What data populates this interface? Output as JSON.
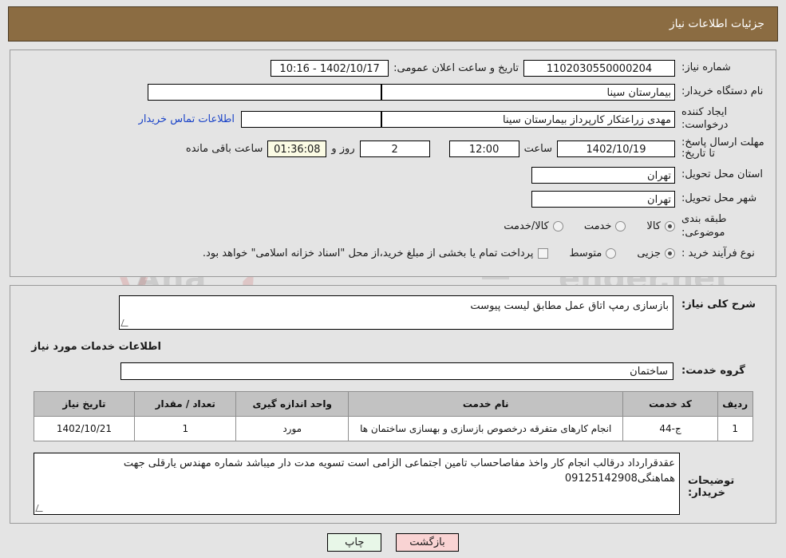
{
  "header": {
    "title": "جزئیات اطلاعات نیاز"
  },
  "form": {
    "need_number_label": "شماره نیاز:",
    "need_number_value": "1102030550000204",
    "announce_datetime_label": "تاریخ و ساعت اعلان عمومی:",
    "announce_datetime_value": "1402/10/17 - 10:16",
    "buyer_org_label": "نام دستگاه خریدار:",
    "buyer_org_value": "بیمارستان سینا",
    "blank_field_value": "",
    "creator_label": "ایجاد کننده درخواست:",
    "creator_value": "مهدی  زراعتکار  کارپرداز بیمارستان سینا",
    "contact_link": "اطلاعات تماس خریدار",
    "deadline_label": "مهلت ارسال پاسخ: تا تاریخ:",
    "deadline_date": "1402/10/19",
    "hour_label": "ساعت",
    "deadline_time": "12:00",
    "days_value": "2",
    "days_text": "روز و",
    "timer_value": "01:36:08",
    "remaining_text": "ساعت باقی مانده",
    "province_label": "استان محل تحویل:",
    "province_value": "تهران",
    "city_label": "شهر محل تحویل:",
    "city_value": "تهران",
    "category_label": "طبقه بندی موضوعی:",
    "category_options": [
      {
        "label": "کالا",
        "checked": true
      },
      {
        "label": "خدمت",
        "checked": false
      },
      {
        "label": "کالا/خدمت",
        "checked": false
      }
    ],
    "process_label": "نوع فرآیند خرید :",
    "process_options": [
      {
        "label": "جزیی",
        "checked": true
      },
      {
        "label": "متوسط",
        "checked": false
      }
    ],
    "treasury_note": "پرداخت تمام یا بخشی از مبلغ خرید،از محل \"اسناد خزانه اسلامی\" خواهد بود.",
    "treasury_checked": false
  },
  "details": {
    "description_label": "شرح کلی نیاز:",
    "description_value": "بازسازی رمپ اتاق عمل مطابق لیست پیوست",
    "services_section_title": "اطلاعات خدمات مورد نیاز",
    "service_group_label": "گروه خدمت:",
    "service_group_value": "ساختمان"
  },
  "table": {
    "columns": [
      "ردیف",
      "کد خدمت",
      "نام خدمت",
      "واحد اندازه گیری",
      "تعداد / مقدار",
      "تاریخ نیاز"
    ],
    "rows": [
      {
        "index": "1",
        "code": "ج-44",
        "name": "انجام کارهای متفرقه درخصوص بازسازی و بهسازی ساختمان ها",
        "unit": "مورد",
        "qty": "1",
        "date": "1402/10/21"
      }
    ]
  },
  "notes": {
    "label": "توضیحات خریدار:",
    "value": "عقدقرارداد درقالب انجام کار واخذ مفاصاحساب تامین اجتماعی الزامی است تسویه مدت دار میباشد شماره مهندس یارقلی جهت هماهنگی09125142908"
  },
  "footer": {
    "print_label": "چاپ",
    "back_label": "بازگشت"
  },
  "watermark": {
    "brand_left": "Ana",
    "brand_right": "ender.net"
  },
  "colors": {
    "header_bg": "#8b6c42",
    "page_bg": "#e4e4e4",
    "link": "#1b44c8",
    "timer_bg": "#fbfbe4",
    "table_header_bg": "#c2c2c2",
    "print_btn_bg": "#e8f7e8",
    "back_btn_bg": "#f9d3d3"
  }
}
